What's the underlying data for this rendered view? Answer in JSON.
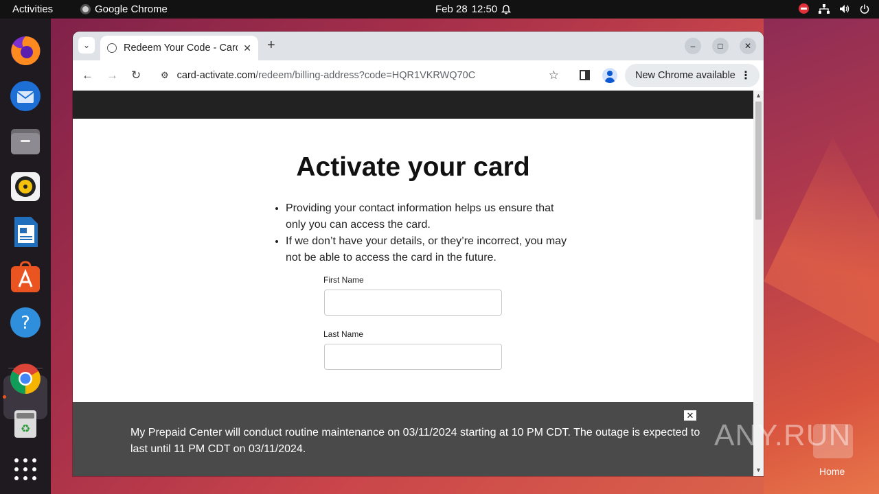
{
  "topbar": {
    "activities": "Activities",
    "app_name": "Google Chrome",
    "date": "Feb 28",
    "time": "12:50"
  },
  "dock": {
    "items": [
      "firefox",
      "thunderbird",
      "files",
      "rhythmbox",
      "libreoffice-writer",
      "app-center",
      "help",
      "chrome",
      "trash",
      "show-apps"
    ]
  },
  "browser": {
    "tab_title": "Redeem Your Code - Card",
    "url_host": "card-activate.com",
    "url_path": "/redeem/billing-address?code=HQR1VKRWQ70C",
    "update_label": "New Chrome available"
  },
  "page": {
    "title": "Activate your card",
    "bullets": [
      "Providing your contact information helps us ensure that only you can access the card.",
      "If we don’t have your details, or they’re incorrect, you may not be able to access the card in the future."
    ],
    "first_name_label": "First Name",
    "last_name_label": "Last Name",
    "banner_text": "My Prepaid Center will conduct routine maintenance on 03/11/2024 starting at 10 PM CDT. The outage is expected to last until 11 PM CDT on 03/11/2024."
  },
  "desktop": {
    "watermark": "ANY.RUN",
    "home_label": "Home"
  }
}
